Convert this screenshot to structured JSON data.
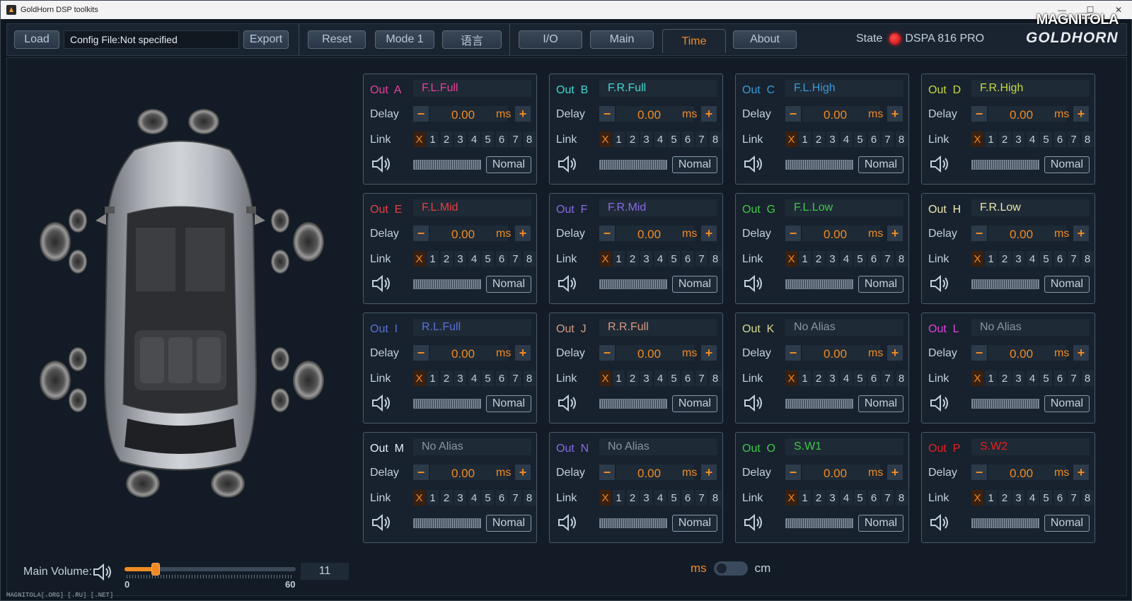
{
  "window": {
    "title": "GoldHorn DSP toolkits",
    "watermark": "MAGNITOLA",
    "footer": "MAGNITOLA[.ORG] [.RU] [.NET]"
  },
  "toolbar": {
    "load": "Load",
    "config": "Config File:Not specified",
    "export": "Export",
    "reset": "Reset",
    "mode": "Mode 1",
    "lang": "语言",
    "tabs": [
      "I/O",
      "Main",
      "Time",
      "About"
    ],
    "active_tab": "Time",
    "state_label": "State",
    "device": "DSPA 816 PRO",
    "logo": "GOLDHORN"
  },
  "channel_common": {
    "delay_label": "Delay",
    "link_label": "Link",
    "delay_value": "0.00",
    "unit": "ms",
    "nomal": "Nomal",
    "link_x": "X",
    "links": [
      "1",
      "2",
      "3",
      "4",
      "5",
      "6",
      "7",
      "8"
    ],
    "minus": "−",
    "plus": "+"
  },
  "channels": [
    {
      "out": "Out  A",
      "alias": "F.L.Full",
      "out_color": "#e8409a",
      "alias_color": "#e8409a"
    },
    {
      "out": "Out  B",
      "alias": "F.R.Full",
      "out_color": "#40d8d0",
      "alias_color": "#40d8d0"
    },
    {
      "out": "Out  C",
      "alias": "F.L.High",
      "out_color": "#3a9ad8",
      "alias_color": "#3a9ad8"
    },
    {
      "out": "Out  D",
      "alias": "F.R.High",
      "out_color": "#c8d840",
      "alias_color": "#c8d840"
    },
    {
      "out": "Out  E",
      "alias": "F.L.Mid",
      "out_color": "#e84040",
      "alias_color": "#e84040"
    },
    {
      "out": "Out  F",
      "alias": "F.R.Mid",
      "out_color": "#8a6ae8",
      "alias_color": "#8a6ae8"
    },
    {
      "out": "Out  G",
      "alias": "F.L.Low",
      "out_color": "#40c848",
      "alias_color": "#40c848"
    },
    {
      "out": "Out  H",
      "alias": "F.R.Low",
      "out_color": "#f0e8b0",
      "alias_color": "#f0e8b0"
    },
    {
      "out": "Out  I",
      "alias": "R.L.Full",
      "out_color": "#5a72d8",
      "alias_color": "#5a72d8"
    },
    {
      "out": "Out  J",
      "alias": "R.R.Full",
      "out_color": "#d89a80",
      "alias_color": "#d89a80"
    },
    {
      "out": "Out  K",
      "alias": "No Alias",
      "out_color": "#d8d890",
      "alias_color": "#8a96a4"
    },
    {
      "out": "Out  L",
      "alias": "No Alias",
      "out_color": "#e040e0",
      "alias_color": "#8a96a4"
    },
    {
      "out": "Out  M",
      "alias": "No Alias",
      "out_color": "#e8eef4",
      "alias_color": "#8a96a4"
    },
    {
      "out": "Out  N",
      "alias": "No Alias",
      "out_color": "#8a6ae8",
      "alias_color": "#8a96a4"
    },
    {
      "out": "Out  O",
      "alias": "S.W1",
      "out_color": "#40c848",
      "alias_color": "#40c848"
    },
    {
      "out": "Out  P",
      "alias": "S.W2",
      "out_color": "#e82020",
      "alias_color": "#e82020"
    }
  ],
  "volume": {
    "label": "Main Volume:",
    "value": "11",
    "min": "0",
    "max": "60",
    "level": 0.183
  },
  "units": {
    "ms": "ms",
    "cm": "cm",
    "selected": "ms"
  }
}
